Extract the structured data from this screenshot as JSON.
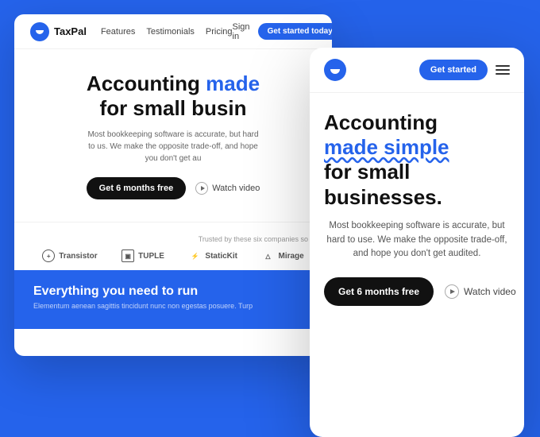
{
  "background_color": "#2563eb",
  "desktop": {
    "nav": {
      "logo_text": "TaxPal",
      "links": [
        "Features",
        "Testimonials",
        "Pricing"
      ],
      "signin_label": "Sign in",
      "get_started_label": "Get started today"
    },
    "hero": {
      "headline_part1": "Accounting made",
      "headline_accent": "made",
      "headline_part2": "for small busin",
      "headline_full": "Accounting made",
      "headline_line2": "for small busin",
      "subtext": "Most bookkeeping software is accurate, but hard to us. We make the opposite trade-off, and hope you don't get au",
      "cta_label": "Get 6 months free",
      "watch_label": "Watch video"
    },
    "trusted": {
      "label": "Trusted by these six companies so fo",
      "companies": [
        {
          "name": "Transistor",
          "icon": "+"
        },
        {
          "name": "TUPLE",
          "icon": "T"
        },
        {
          "name": "StaticKit",
          "icon": "S"
        },
        {
          "name": "Mirage",
          "icon": "M"
        }
      ]
    },
    "bottom": {
      "headline": "Everything you need to run",
      "subtext": "Elementum aenean sagittis tincidunt nunc non egestas posuere. Turp"
    }
  },
  "mobile": {
    "nav": {
      "get_started_label": "Get started",
      "menu_icon": "hamburger"
    },
    "hero": {
      "headline_line1": "Accounting",
      "headline_line2": "made simple",
      "headline_line3": "for small",
      "headline_line4": "businesses.",
      "subtext": "Most bookkeeping software is accurate, but hard to use. We make the opposite trade-off, and hope you don't get audited.",
      "cta_label": "Get 6 months free",
      "watch_label": "Watch video"
    }
  }
}
